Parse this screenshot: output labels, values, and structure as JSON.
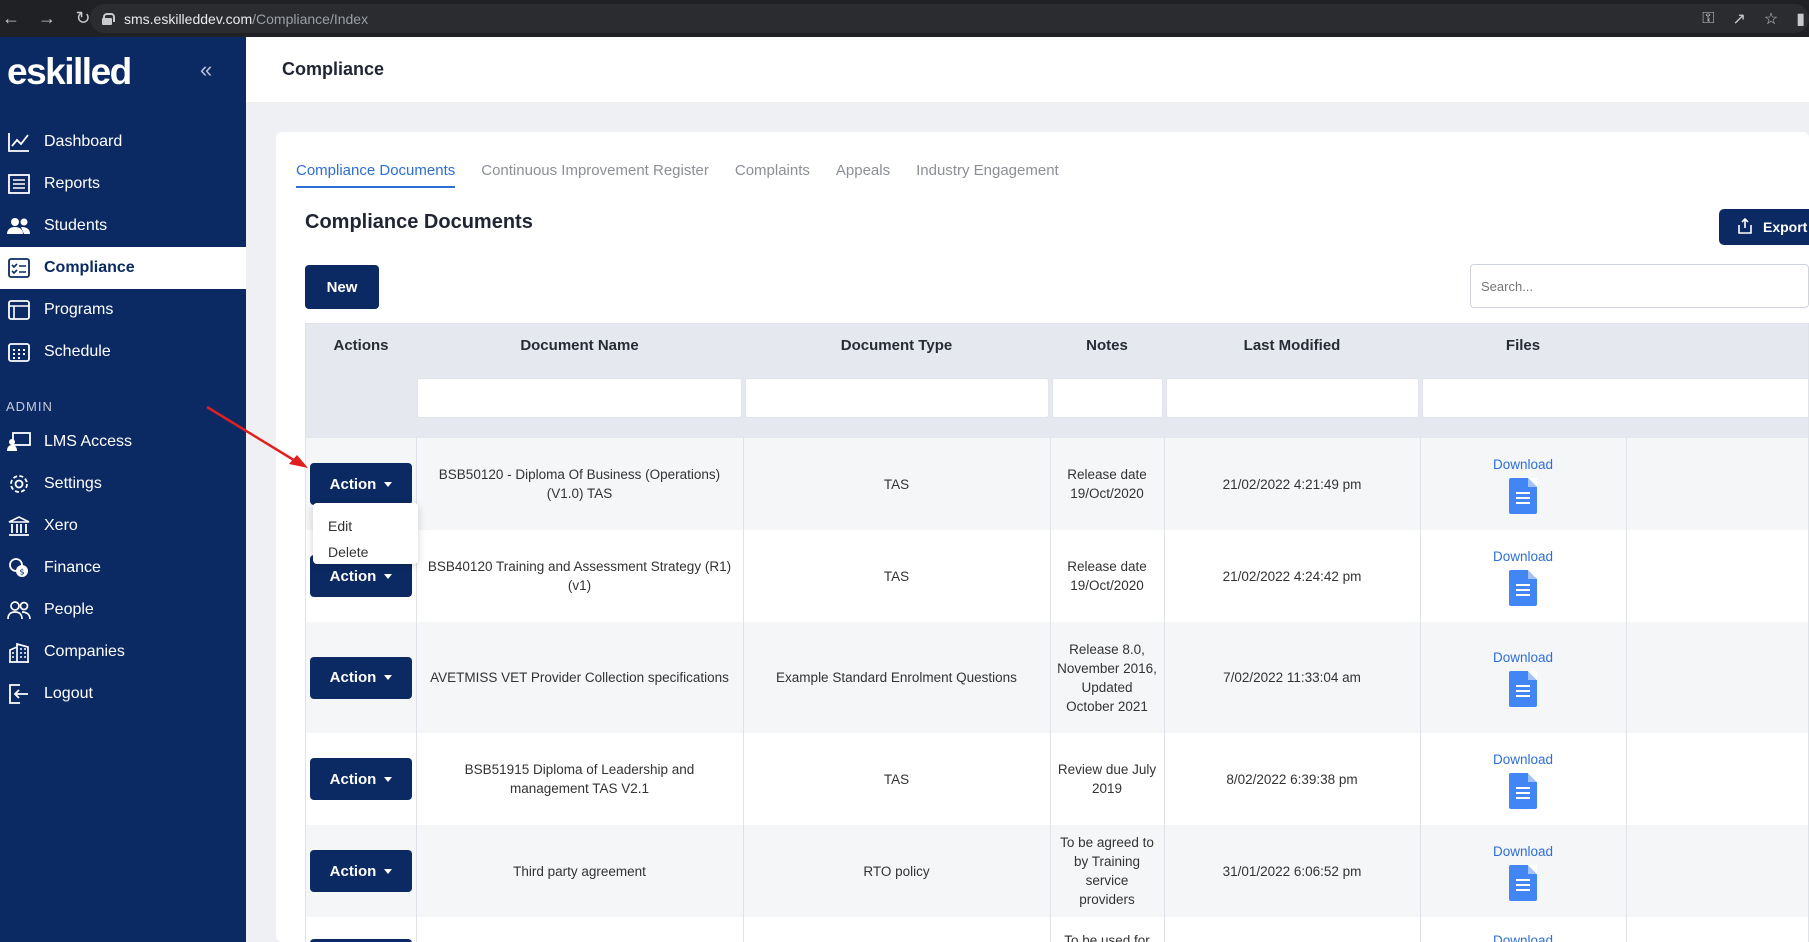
{
  "browser": {
    "url_host": "sms.eskilleddev.com",
    "url_path": "/Compliance/Index"
  },
  "sidebar": {
    "logo": "eskilled",
    "items": [
      {
        "label": "Dashboard",
        "icon": "chart-line-icon"
      },
      {
        "label": "Reports",
        "icon": "report-icon"
      },
      {
        "label": "Students",
        "icon": "users-icon"
      },
      {
        "label": "Compliance",
        "icon": "checklist-icon",
        "active": true
      },
      {
        "label": "Programs",
        "icon": "browser-window-icon"
      },
      {
        "label": "Schedule",
        "icon": "calendar-icon"
      }
    ],
    "admin_label": "ADMIN",
    "admin_items": [
      {
        "label": "LMS Access",
        "icon": "presentation-icon"
      },
      {
        "label": "Settings",
        "icon": "gear-icon"
      },
      {
        "label": "Xero",
        "icon": "bank-icon"
      },
      {
        "label": "Finance",
        "icon": "coins-icon"
      },
      {
        "label": "People",
        "icon": "people-icon"
      },
      {
        "label": "Companies",
        "icon": "building-icon"
      },
      {
        "label": "Logout",
        "icon": "logout-icon"
      }
    ]
  },
  "header": {
    "title": "Compliance"
  },
  "tabs": [
    {
      "label": "Compliance Documents",
      "active": true
    },
    {
      "label": "Continuous Improvement Register"
    },
    {
      "label": "Complaints"
    },
    {
      "label": "Appeals"
    },
    {
      "label": "Industry Engagement"
    }
  ],
  "section": {
    "title": "Compliance Documents",
    "export_label": "Export",
    "new_label": "New",
    "search_placeholder": "Search..."
  },
  "table": {
    "columns": [
      "Actions",
      "Document Name",
      "Document Type",
      "Notes",
      "Last Modified",
      "Files"
    ],
    "action_label": "Action",
    "download_label": "Download",
    "rows": [
      {
        "name": "BSB50120 - Diploma Of Business (Operations) (V1.0) TAS",
        "type": "TAS",
        "notes": "Release date 19/Oct/2020",
        "modified": "21/02/2022 4:21:49 pm"
      },
      {
        "name": "BSB40120 Training and Assessment Strategy (R1) (v1)",
        "type": "TAS",
        "notes": "Release date 19/Oct/2020",
        "modified": "21/02/2022 4:24:42 pm"
      },
      {
        "name": "AVETMISS VET Provider Collection specifications",
        "type": "Example Standard Enrolment Questions",
        "notes": "Release 8.0, November 2016, Updated October 2021",
        "modified": "7/02/2022 11:33:04 am"
      },
      {
        "name": "BSB51915 Diploma of Leadership and management TAS V2.1",
        "type": "TAS",
        "notes": "Review due July 2019",
        "modified": "8/02/2022 6:39:38 pm"
      },
      {
        "name": "Third party agreement",
        "type": "RTO policy",
        "notes": "To be agreed to by Training service providers",
        "modified": "31/01/2022 6:06:52 pm"
      },
      {
        "name": "",
        "type": "",
        "notes": "To be used for",
        "modified": ""
      }
    ]
  },
  "dropdown": {
    "items": [
      "Edit",
      "Delete"
    ]
  },
  "colors": {
    "navy": "#0b2a63",
    "link": "#2d6fd8",
    "annotation_arrow": "#e02020"
  }
}
